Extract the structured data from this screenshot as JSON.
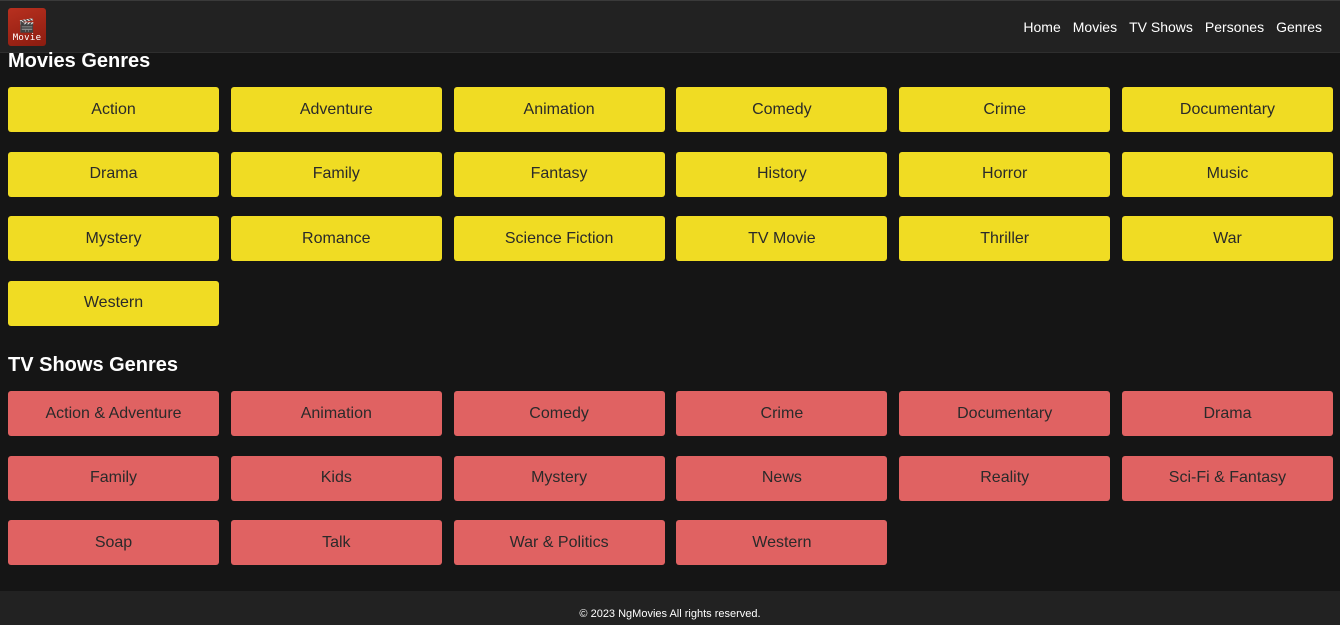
{
  "logo": {
    "text": "Movie"
  },
  "nav": {
    "links": [
      "Home",
      "Movies",
      "TV Shows",
      "Persones",
      "Genres"
    ]
  },
  "movies_section": {
    "title": "Movies Genres",
    "genres": [
      "Action",
      "Adventure",
      "Animation",
      "Comedy",
      "Crime",
      "Documentary",
      "Drama",
      "Family",
      "Fantasy",
      "History",
      "Horror",
      "Music",
      "Mystery",
      "Romance",
      "Science Fiction",
      "TV Movie",
      "Thriller",
      "War",
      "Western"
    ]
  },
  "tv_section": {
    "title": "TV Shows Genres",
    "genres": [
      "Action & Adventure",
      "Animation",
      "Comedy",
      "Crime",
      "Documentary",
      "Drama",
      "Family",
      "Kids",
      "Mystery",
      "News",
      "Reality",
      "Sci-Fi & Fantasy",
      "Soap",
      "Talk",
      "War & Politics",
      "Western"
    ]
  },
  "footer": {
    "text": "© 2023 NgMovies All rights reserved."
  },
  "colors": {
    "movie_button": "#f0dc23",
    "tv_button": "#e06262",
    "background": "#151515",
    "navbar": "#222222"
  }
}
